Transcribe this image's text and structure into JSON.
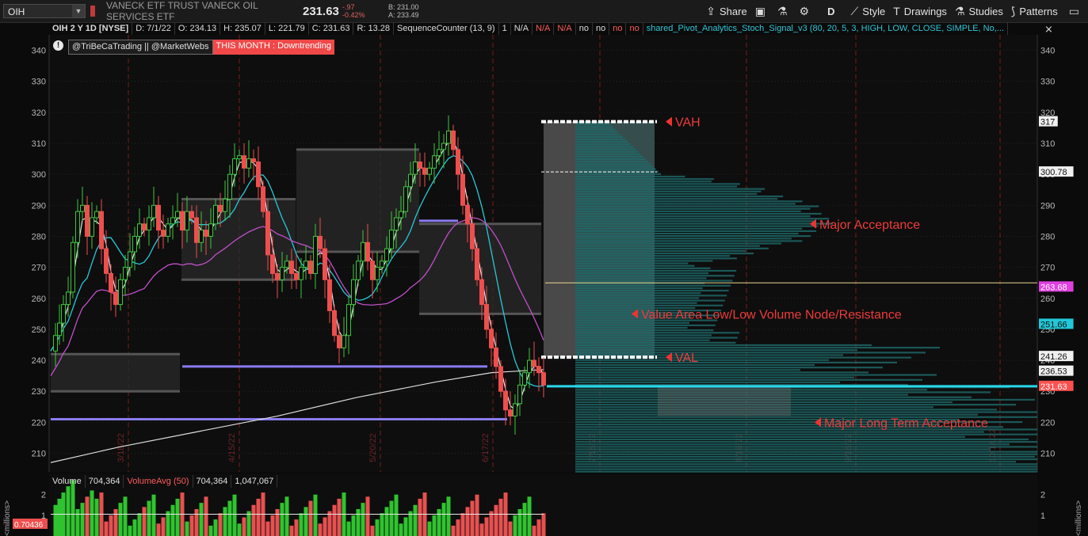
{
  "header": {
    "symbol": "OIH",
    "description": "VANECK ETF TRUST VANECK OIL SERVICES ETF",
    "last": "231.63",
    "change": "-.97",
    "change_pct": "-0.42%",
    "bid": "B: 231.00",
    "ask": "A: 233.49",
    "share_label": "Share",
    "period_label": "D",
    "style_label": "Style",
    "drawings_label": "Drawings",
    "studies_label": "Studies",
    "patterns_label": "Patterns"
  },
  "subheader": {
    "title": "OIH 2 Y 1D [NYSE]",
    "date": "D: 7/1/22",
    "open": "O: 234.13",
    "high": "H: 235.07",
    "low": "L: 221.79",
    "close": "C: 231.63",
    "range": "R: 13.28",
    "study1": "SequenceCounter (13, 9)",
    "v1": "1",
    "v2": "N/A",
    "v3": "N/A",
    "v4": "N/A",
    "v5": "no",
    "v6": "no",
    "v7": "no",
    "v8": "no",
    "study2": "shared_Pivot_Analytics_Stoch_Signal_v3 (80, 20, 5, 3, HIGH, LOW, CLOSE, SIMPLE, No,..."
  },
  "badges": {
    "authors": "@TriBeCaTrading || @MarketWebs",
    "month": "THIS MONTH : Downtrending"
  },
  "volume_header": {
    "label": "Volume",
    "value": "704,364",
    "avg_label": "VolumeAvg (50)",
    "avg_value": "704,364",
    "avg2": "1,047,067",
    "axis_unit": "<millions>",
    "cur_vol": "0.70436"
  },
  "chart_data": {
    "type": "candlestick",
    "ylim": [
      204,
      345
    ],
    "yticks": [
      210,
      220,
      230,
      240,
      250,
      260,
      270,
      280,
      290,
      300,
      310,
      320,
      330,
      340
    ],
    "date_labels": [
      "3/18/22",
      "4/15/22",
      "5/20/22",
      "6/17/22",
      "7/15/22",
      "8/19/22",
      "9/16/22",
      "10/14/22"
    ],
    "price_markers": [
      {
        "value": 317,
        "label": "317",
        "color": "#ffffff"
      },
      {
        "value": 300.78,
        "label": "300.78",
        "color": "#ffffff"
      },
      {
        "value": 263.68,
        "label": "263.68",
        "color": "#e040e0"
      },
      {
        "value": 251.66,
        "label": "251.66",
        "color": "#20c8d8"
      },
      {
        "value": 241.26,
        "label": "241.26",
        "color": "#ffffff"
      },
      {
        "value": 236.53,
        "label": "236.53",
        "color": "#ffffff"
      },
      {
        "value": 231.63,
        "label": "231.63",
        "color": "#ff5050"
      }
    ],
    "annotations": [
      {
        "text": "VAH",
        "price": 317
      },
      {
        "text": "Major Acceptance",
        "price": 284
      },
      {
        "text": "Value Area Low/Low Volume Node/Resistance",
        "price": 255
      },
      {
        "text": "VAL",
        "price": 241
      },
      {
        "text": "Major Long Term Acceptance",
        "price": 220
      }
    ],
    "volume_profile": {
      "vah": 317,
      "poc": 265,
      "val": 241,
      "current": 231.63
    },
    "volume_ticks": [
      1,
      2
    ]
  }
}
